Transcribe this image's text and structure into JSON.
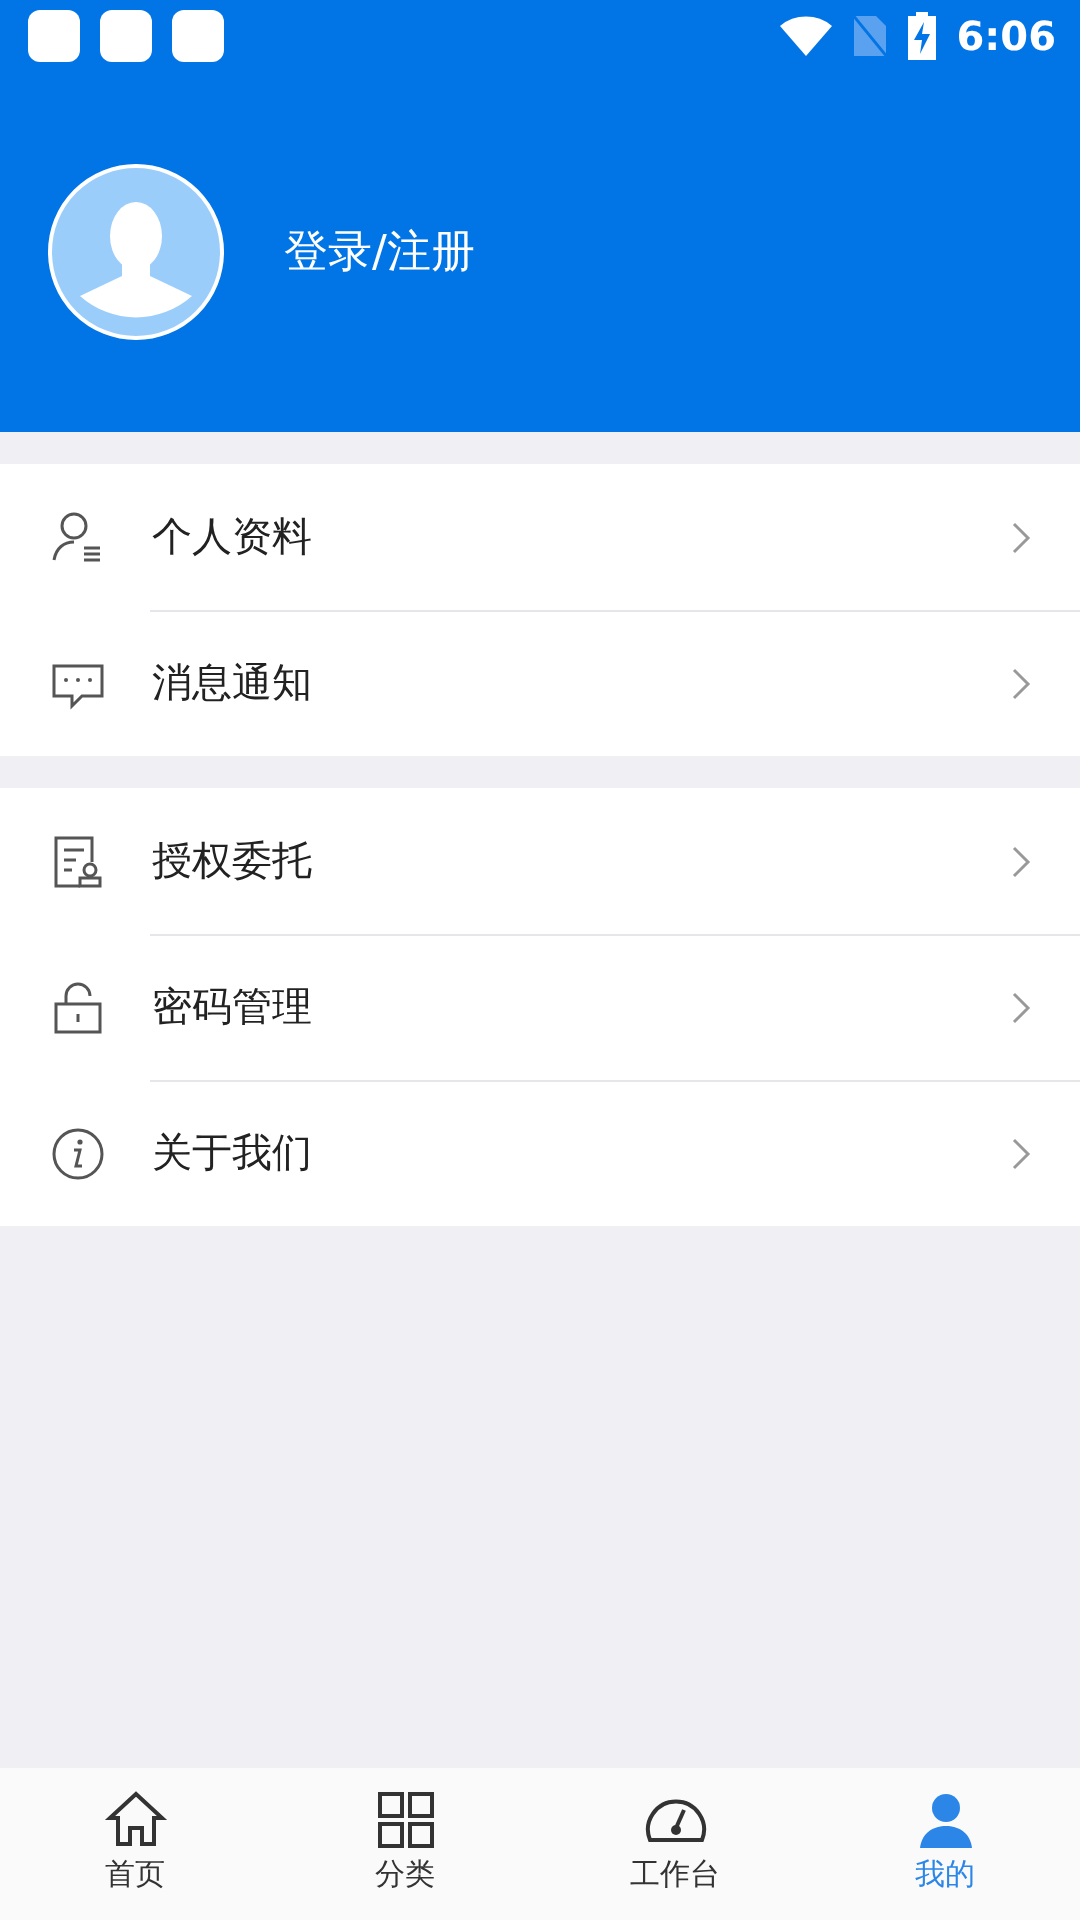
{
  "status_bar": {
    "time": "6:06"
  },
  "profile": {
    "login_label": "登录/注册"
  },
  "menu_groups": [
    {
      "items": [
        {
          "kind": "profile",
          "label": "个人资料"
        },
        {
          "kind": "message",
          "label": "消息通知"
        }
      ]
    },
    {
      "items": [
        {
          "kind": "authorize",
          "label": "授权委托"
        },
        {
          "kind": "password",
          "label": "密码管理"
        },
        {
          "kind": "about",
          "label": "关于我们"
        }
      ]
    }
  ],
  "tab_bar": [
    {
      "kind": "home",
      "label": "首页",
      "selected": false
    },
    {
      "kind": "category",
      "label": "分类",
      "selected": false
    },
    {
      "kind": "workbench",
      "label": "工作台",
      "selected": false
    },
    {
      "kind": "mine",
      "label": "我的",
      "selected": true
    }
  ]
}
